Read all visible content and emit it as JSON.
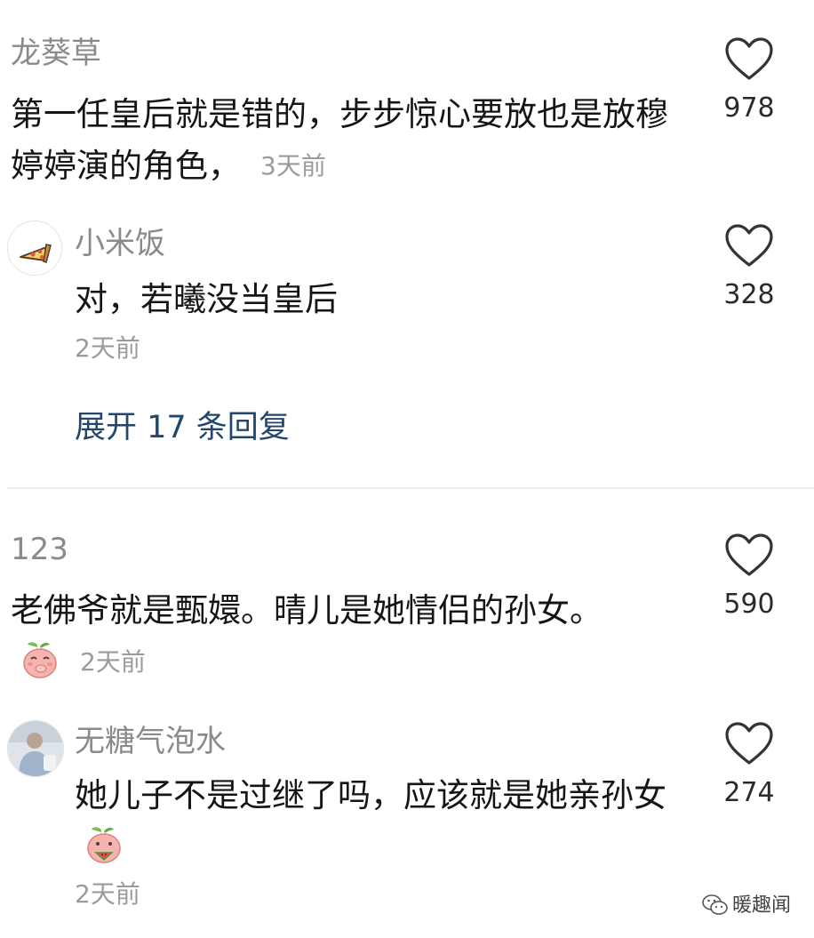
{
  "comments": [
    {
      "username": "龙葵草",
      "text": "第一任皇后就是错的，步步惊心要放也是放穆婷婷演的角色，",
      "time": "3天前",
      "likes": "978",
      "reply": {
        "username": "小米饭",
        "text": "对，若曦没当皇后",
        "time": "2天前",
        "likes": "328"
      },
      "expand_label": "展开 17 条回复"
    },
    {
      "username": "123",
      "text": "老佛爷就是甄嬛。晴儿是她情侣的孙女。",
      "time": "2天前",
      "likes": "590",
      "reply": {
        "username": "无糖气泡水",
        "text": "她儿子不是过继了吗，应该就是她亲孙女",
        "time": "2天前",
        "likes": "274"
      }
    }
  ],
  "watermark": {
    "text": "暖趣闻",
    "icon": "wechat-icon"
  },
  "icons": {
    "like": "heart-outline-icon",
    "avatar_reply_1": "pizza-slice-icon",
    "emoji_1": "peach-covering-mouth-emoji",
    "emoji_2": "peach-eating-watermelon-emoji"
  },
  "colors": {
    "expand_link": "#23466b",
    "username": "#8a8a8a",
    "time": "#9b9b9b"
  }
}
